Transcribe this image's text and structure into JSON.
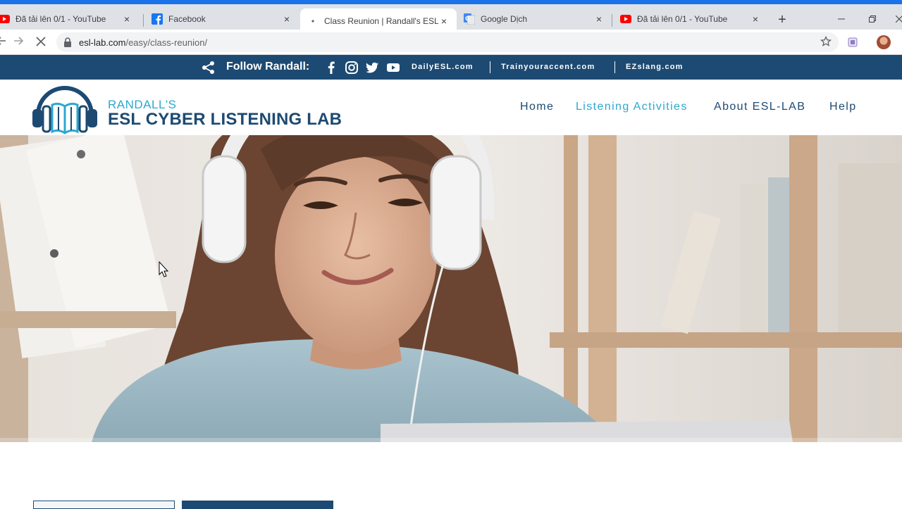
{
  "browser": {
    "tabs": [
      {
        "title": "Đã tải lên 0/1 - YouTube",
        "favicon": "youtube-icon"
      },
      {
        "title": "Facebook",
        "favicon": "facebook-icon"
      },
      {
        "title": "Class Reunion | Randall's ESL C",
        "favicon": "loading-dot-icon",
        "active": true
      },
      {
        "title": "Google Dịch",
        "favicon": "google-translate-icon"
      },
      {
        "title": "Đã tải lên 0/1 - YouTube",
        "favicon": "youtube-icon"
      }
    ],
    "close_glyph": "×",
    "new_tab_glyph": "+",
    "address": {
      "host": "esl-lab.com",
      "path": "/easy/class-reunion/"
    }
  },
  "site": {
    "topbar": {
      "follow_label": "Follow Randall:",
      "links": [
        "DailyESL.com",
        "Trainyouraccent.com",
        "EZslang.com"
      ]
    },
    "logo": {
      "line1": "RANDALL'S",
      "line2": "ESL CYBER LISTENING LAB"
    },
    "nav": [
      {
        "label": "Home",
        "active": false
      },
      {
        "label": "Listening Activities",
        "active": true
      },
      {
        "label": "About ESL-LAB",
        "active": false
      },
      {
        "label": "Help",
        "active": false
      }
    ]
  },
  "colors": {
    "brand_navy": "#1d4a72",
    "brand_cyan": "#2ba8d0",
    "chrome_accent": "#1a73e8"
  }
}
